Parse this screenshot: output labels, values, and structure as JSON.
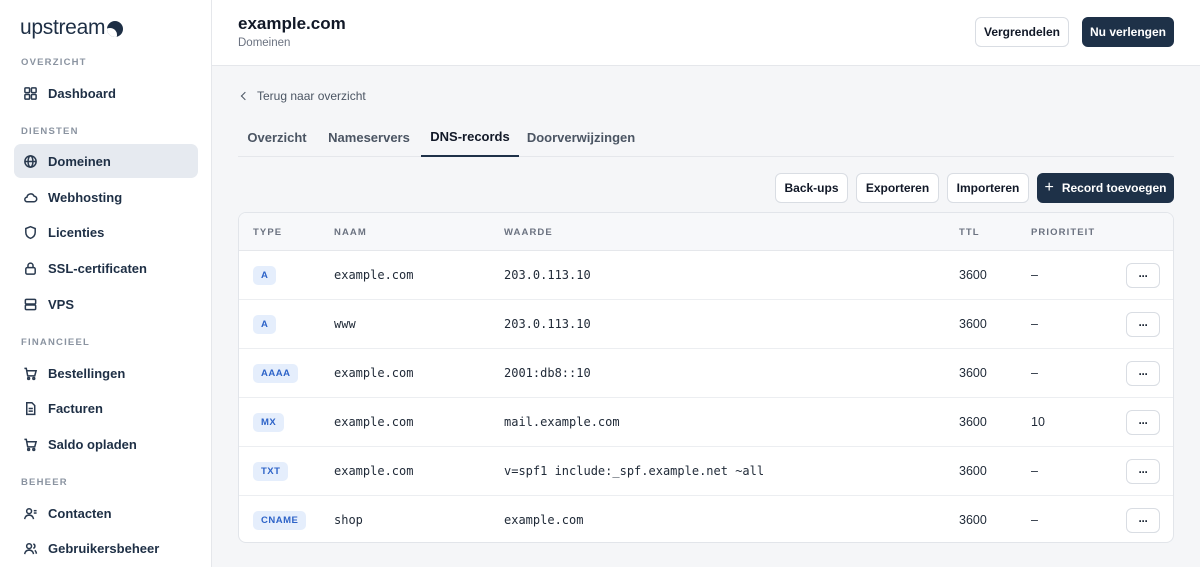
{
  "brand": {
    "name": "upstream"
  },
  "sidebar": {
    "sections": [
      {
        "label": "OVERZICHT"
      },
      {
        "label": "DIENSTEN"
      },
      {
        "label": "FINANCIEEL"
      },
      {
        "label": "BEHEER"
      }
    ],
    "items": [
      {
        "label": "Dashboard",
        "icon": "grid-icon"
      },
      {
        "label": "Domeinen",
        "icon": "globe-icon",
        "active": true
      },
      {
        "label": "Webhosting",
        "icon": "cloud-icon"
      },
      {
        "label": "Licenties",
        "icon": "shield-icon"
      },
      {
        "label": "SSL-certificaten",
        "icon": "lock-icon"
      },
      {
        "label": "VPS",
        "icon": "server-icon"
      },
      {
        "label": "Bestellingen",
        "icon": "cart-icon"
      },
      {
        "label": "Facturen",
        "icon": "document-icon"
      },
      {
        "label": "Saldo opladen",
        "icon": "cart-icon"
      },
      {
        "label": "Contacten",
        "icon": "contacts-icon"
      },
      {
        "label": "Gebruikersbeheer",
        "icon": "users-icon"
      }
    ]
  },
  "header": {
    "title": "example.com",
    "subtitle": "Domeinen",
    "actions": {
      "secondary": "Vergrendelen",
      "primary": "Nu verlengen"
    }
  },
  "main": {
    "back_label": "Terug naar overzicht",
    "tabs": [
      {
        "label": "Overzicht"
      },
      {
        "label": "Nameservers"
      },
      {
        "label": "DNS-records",
        "active": true
      },
      {
        "label": "Doorverwijzingen"
      }
    ],
    "toolbar": {
      "backups": "Back-ups",
      "export": "Exporteren",
      "import": "Importeren",
      "add_record": "Record toevoegen"
    },
    "table": {
      "columns": [
        "TYPE",
        "NAAM",
        "WAARDE",
        "TTL",
        "PRIORITEIT"
      ],
      "rows": [
        {
          "type": "A",
          "name": "example.com",
          "value": "203.0.113.10",
          "ttl": "3600",
          "priority": "–"
        },
        {
          "type": "A",
          "name": "www",
          "value": "203.0.113.10",
          "ttl": "3600",
          "priority": "–"
        },
        {
          "type": "AAAA",
          "name": "example.com",
          "value": "2001:db8::10",
          "ttl": "3600",
          "priority": "–"
        },
        {
          "type": "MX",
          "name": "example.com",
          "value": "mail.example.com",
          "ttl": "3600",
          "priority": "10"
        },
        {
          "type": "TXT",
          "name": "example.com",
          "value": "v=spf1 include:_spf.example.net ~all",
          "ttl": "3600",
          "priority": "–"
        },
        {
          "type": "CNAME",
          "name": "shop",
          "value": "example.com",
          "ttl": "3600",
          "priority": "–"
        }
      ],
      "row_action": "···"
    }
  },
  "colors": {
    "primary": "#1e3148",
    "badge_bg": "#e5eefc",
    "badge_text": "#2d63c8",
    "active_nav_bg": "#e6eaf0"
  }
}
